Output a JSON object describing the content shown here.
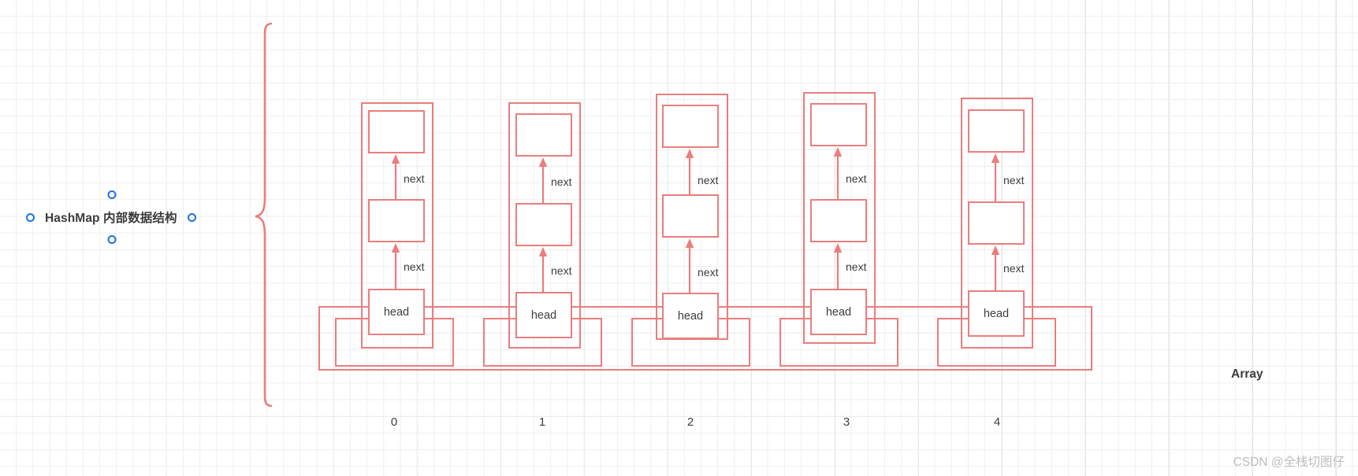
{
  "diagram": {
    "title": "HashMap 内部数据结构",
    "array_label": "Array",
    "watermark": "CSDN @全栈切图仔",
    "accent_color": "#ea7d7d",
    "handle_color": "#1a73e8",
    "text_color": "#3d3d3d"
  },
  "icons": {
    "handle_left": "selection-handle",
    "handle_right": "selection-handle",
    "handle_top": "selection-handle",
    "handle_bottom": "selection-handle",
    "brace": "left-curly-brace"
  },
  "buckets": [
    {
      "index": "0",
      "nodes": [
        {
          "label": ""
        },
        {
          "label": ""
        },
        {
          "label": "head"
        }
      ],
      "links": [
        "next",
        "next"
      ]
    },
    {
      "index": "1",
      "nodes": [
        {
          "label": ""
        },
        {
          "label": ""
        },
        {
          "label": "head"
        }
      ],
      "links": [
        "next",
        "next"
      ]
    },
    {
      "index": "2",
      "nodes": [
        {
          "label": ""
        },
        {
          "label": ""
        },
        {
          "label": "head"
        }
      ],
      "links": [
        "next",
        "next"
      ]
    },
    {
      "index": "3",
      "nodes": [
        {
          "label": ""
        },
        {
          "label": ""
        },
        {
          "label": "head"
        }
      ],
      "links": [
        "next",
        "next"
      ]
    },
    {
      "index": "4",
      "nodes": [
        {
          "label": ""
        },
        {
          "label": ""
        },
        {
          "label": "head"
        }
      ],
      "links": [
        "next",
        "next"
      ]
    }
  ]
}
